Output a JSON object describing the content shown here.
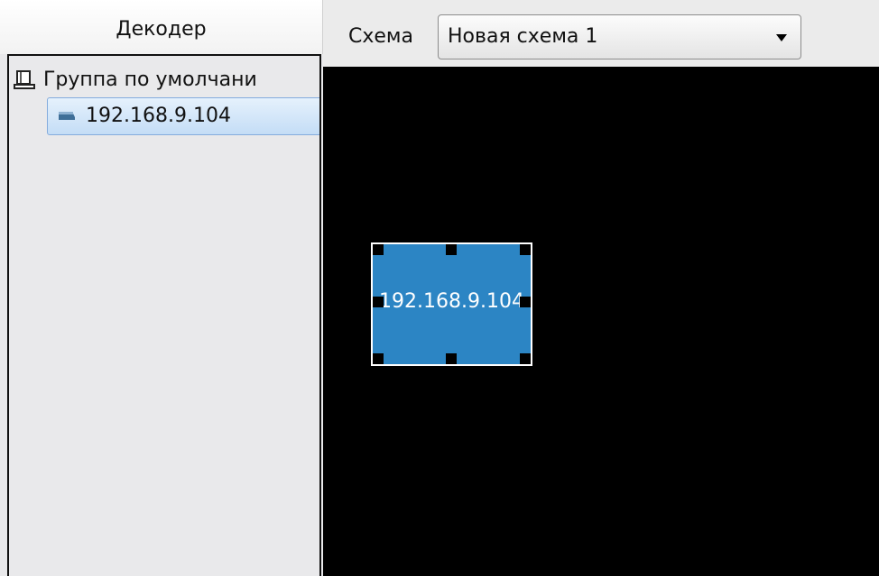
{
  "decoder_panel": {
    "title": "Декодер",
    "group": {
      "label": "Группа по умолчани",
      "icon": "monitor-group-icon"
    },
    "device": {
      "label": "192.168.9.104",
      "icon": "decoder-device-icon"
    }
  },
  "scheme_bar": {
    "label": "Схема",
    "selected": "Новая схема 1",
    "icon": "chevron-down-icon"
  },
  "canvas": {
    "window": {
      "label": "192.168.9.104"
    }
  },
  "colors": {
    "selection": "#2c85c4",
    "canvas_bg": "#000000",
    "tree_selected": "#c4ddf6"
  }
}
